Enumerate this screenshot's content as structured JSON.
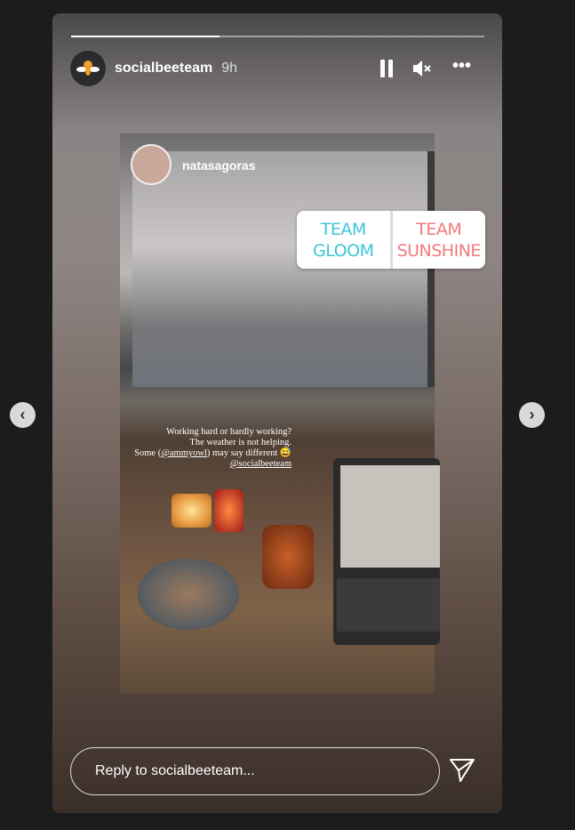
{
  "story": {
    "progress_percent": 36,
    "username": "socialbeeteam",
    "time_ago": "9h"
  },
  "controls": {
    "pause_icon": "pause-icon",
    "mute_icon": "muted-speaker-icon",
    "more_icon": "more-horizontal-icon",
    "more_label": "•••"
  },
  "post": {
    "author": "natasagoras",
    "caption": {
      "line1": "Working hard or hardly working?",
      "line2": "The weather is not helping.",
      "line3_pre": "Some (",
      "mention1": "@ammyowl",
      "line3_post": ") may say different 😅",
      "mention2": "@socialbeeteam"
    }
  },
  "poll": {
    "option1": "TEAM GLOOM",
    "option2_line1": "TEAM",
    "option2_line2": "SUNSHINE",
    "colors": {
      "option1": "#3dc6d8",
      "option2": "#f27a7a"
    }
  },
  "nav": {
    "prev": "‹",
    "next": "›"
  },
  "reply": {
    "placeholder": "Reply to socialbeeteam..."
  }
}
